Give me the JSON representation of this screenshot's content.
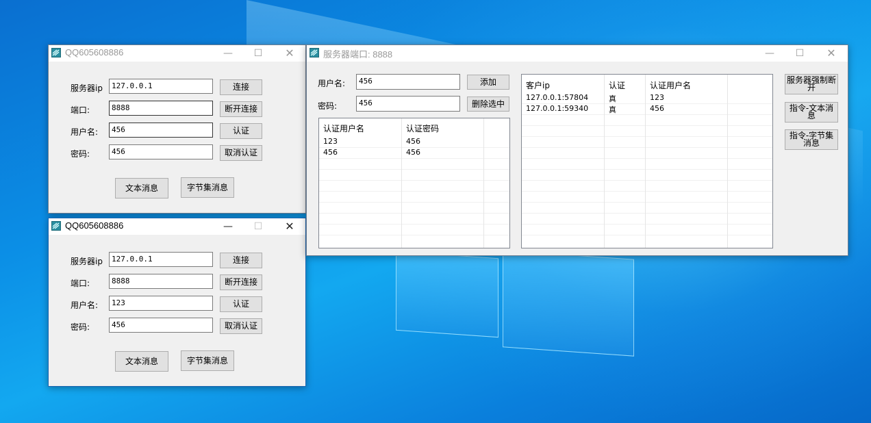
{
  "client1": {
    "title": "QQ605608886",
    "labels": {
      "ip": "服务器ip",
      "port": "端口:",
      "user": "用户名:",
      "pass": "密码:"
    },
    "values": {
      "ip": "127.0.0.1",
      "port": "8888",
      "user": "456",
      "pass": "456"
    },
    "buttons": {
      "connect": "连接",
      "disconnect": "断开连接",
      "auth": "认证",
      "cancel_auth": "取消认证",
      "text_msg": "文本消息",
      "byte_msg": "字节集消息"
    }
  },
  "client2": {
    "title": "QQ605608886",
    "labels": {
      "ip": "服务器ip",
      "port": "端口:",
      "user": "用户名:",
      "pass": "密码:"
    },
    "values": {
      "ip": "127.0.0.1",
      "port": "8888",
      "user": "123",
      "pass": "456"
    },
    "buttons": {
      "connect": "连接",
      "disconnect": "断开连接",
      "auth": "认证",
      "cancel_auth": "取消认证",
      "text_msg": "文本消息",
      "byte_msg": "字节集消息"
    }
  },
  "server": {
    "title": "服务器端口: 8888",
    "labels": {
      "user": "用户名:",
      "pass": "密码:"
    },
    "values": {
      "user": "456",
      "pass": "456"
    },
    "buttons": {
      "add": "添加",
      "delete_selected": "删除选中",
      "force_disconnect": "服务器强制断开",
      "cmd_text": "指令-文本消息",
      "cmd_bytes": "指令-字节集消息"
    },
    "users_table": {
      "headers": [
        "认证用户名",
        "认证密码"
      ],
      "rows": [
        [
          "123",
          "456"
        ],
        [
          "456",
          "456"
        ]
      ]
    },
    "clients_table": {
      "headers": [
        "客户ip",
        "认证",
        "认证用户名"
      ],
      "rows": [
        [
          "127.0.0.1:57804",
          "真",
          "123"
        ],
        [
          "127.0.0.1:59340",
          "真",
          "456"
        ]
      ]
    }
  }
}
